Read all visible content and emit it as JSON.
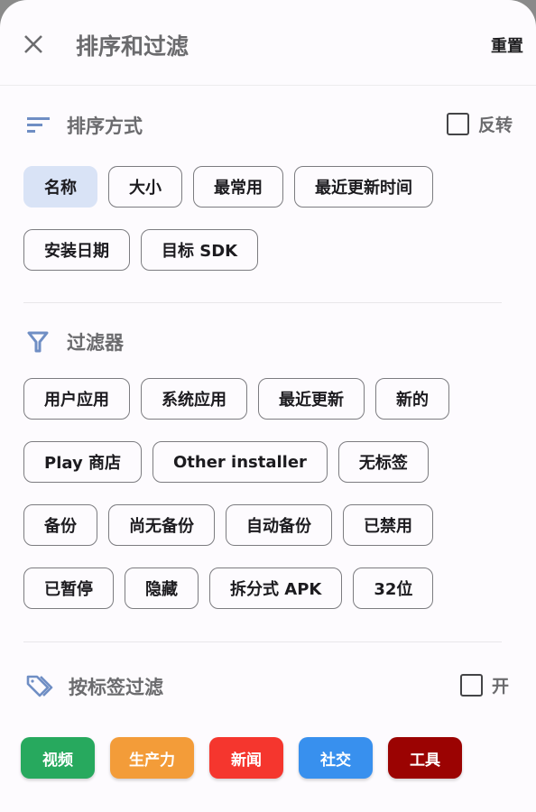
{
  "header": {
    "title": "排序和过滤",
    "reset_label": "重置"
  },
  "sort": {
    "title": "排序方式",
    "reverse_label": "反转",
    "reverse_checked": false,
    "rows": [
      [
        {
          "label": "名称",
          "selected": true
        },
        {
          "label": "大小"
        },
        {
          "label": "最常用"
        },
        {
          "label": "最近更新时间"
        }
      ],
      [
        {
          "label": "安装日期"
        },
        {
          "label": "目标 SDK"
        }
      ]
    ]
  },
  "filters": {
    "title": "过滤器",
    "rows": [
      [
        {
          "label": "用户应用"
        },
        {
          "label": "系统应用"
        },
        {
          "label": "最近更新"
        },
        {
          "label": "新的"
        }
      ],
      [
        {
          "label": "Play 商店"
        },
        {
          "label": "Other installer"
        },
        {
          "label": "无标签"
        }
      ],
      [
        {
          "label": "备份"
        },
        {
          "label": "尚无备份"
        },
        {
          "label": "自动备份"
        },
        {
          "label": "已禁用"
        }
      ],
      [
        {
          "label": "已暂停"
        },
        {
          "label": "隐藏"
        },
        {
          "label": "拆分式 APK"
        },
        {
          "label": "32位"
        }
      ]
    ]
  },
  "tag_filter": {
    "title": "按标签过滤",
    "toggle_label": "开",
    "toggle_checked": false,
    "tags": [
      {
        "label": "视频",
        "color": "#27a95e"
      },
      {
        "label": "生产力",
        "color": "#f39c39"
      },
      {
        "label": "新闻",
        "color": "#f5362e"
      },
      {
        "label": "社交",
        "color": "#3890ee"
      },
      {
        "label": "工具",
        "color": "#9b0302"
      }
    ]
  },
  "colors": {
    "accent_icon": "#6f8ec4",
    "selected_chip": "#d9e3f6"
  }
}
